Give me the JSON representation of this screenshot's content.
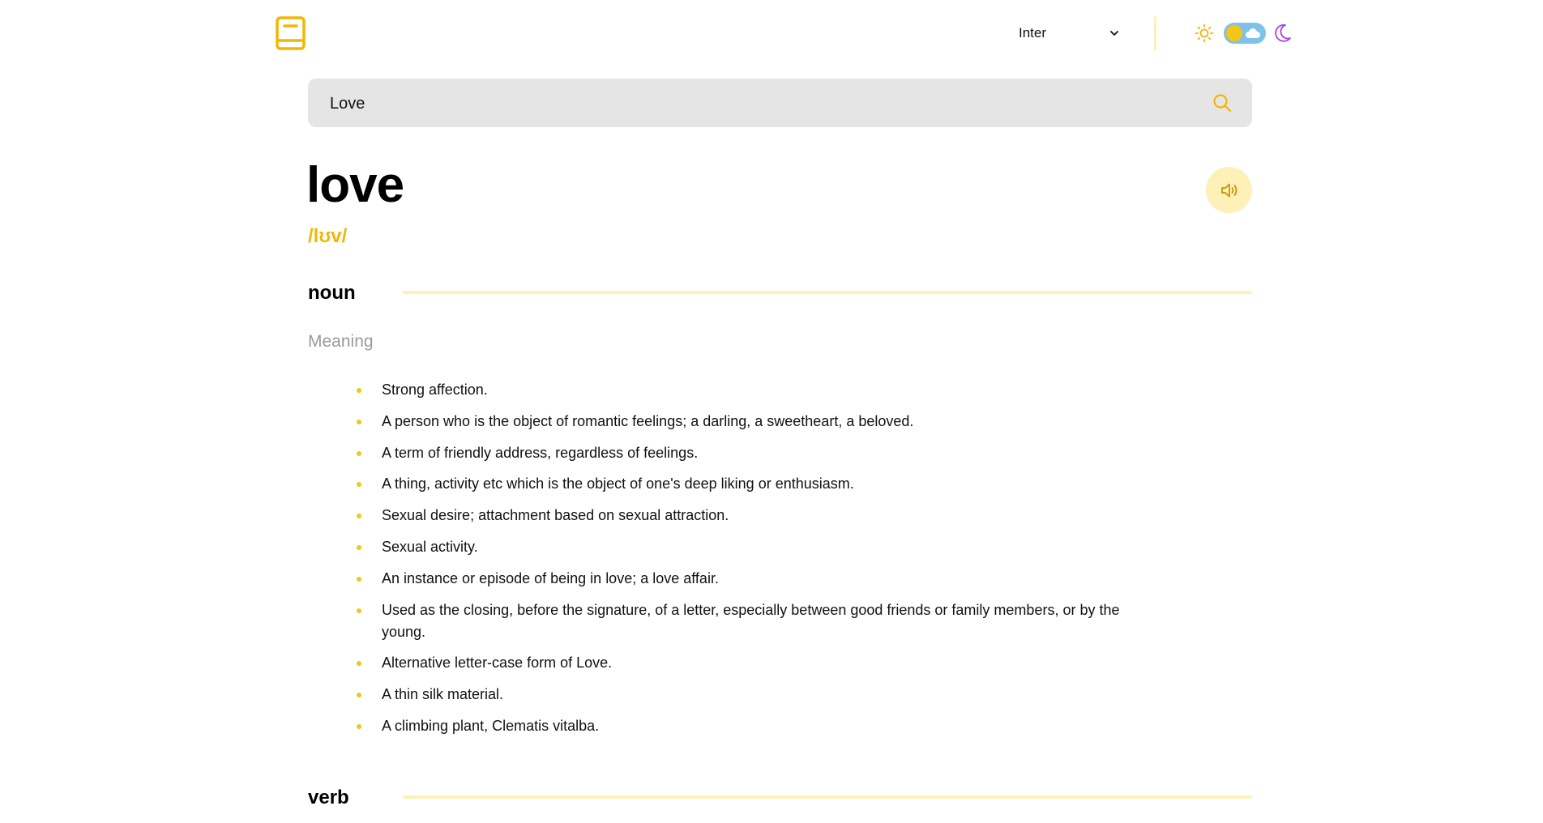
{
  "header": {
    "logo_icon": "book-icon",
    "font_selected": "Inter",
    "theme_icons": [
      "sun-icon",
      "toggle",
      "moon-icon"
    ]
  },
  "search": {
    "value": "Love",
    "icon": "search-icon"
  },
  "entry": {
    "word": "love",
    "phonetic": "/lʊv/",
    "audio_icon": "speaker-icon"
  },
  "meanings": [
    {
      "part_of_speech": "noun",
      "label": "Meaning",
      "definitions": [
        "Strong affection.",
        "A person who is the object of romantic feelings; a darling, a sweetheart, a beloved.",
        "A term of friendly address, regardless of feelings.",
        "A thing, activity etc which is the object of one's deep liking or enthusiasm.",
        "Sexual desire; attachment based on sexual attraction.",
        "Sexual activity.",
        "An instance or episode of being in love; a love affair.",
        "Used as the closing, before the signature, of a letter, especially between good friends or family members, or by the young.",
        "Alternative letter-case form of Love.",
        "A thin silk material.",
        "A climbing plant, Clematis vitalba."
      ]
    },
    {
      "part_of_speech": "verb"
    }
  ],
  "colors": {
    "accent": "#f5c518",
    "accent_light": "#fdf1b8",
    "moon": "#a445ed",
    "toggle_track": "#7ec2ea",
    "search_bg": "#e5e5e5"
  }
}
